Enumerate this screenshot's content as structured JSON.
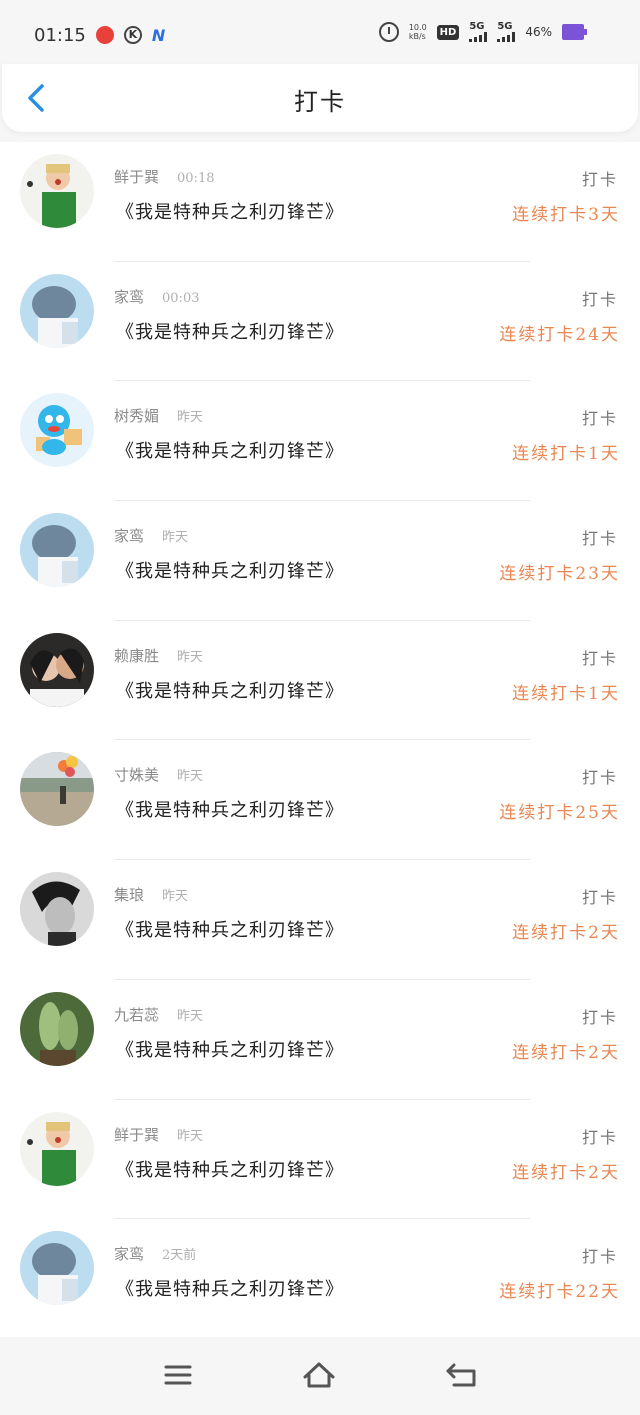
{
  "status": {
    "time": "01:15",
    "net_speed_top": "10.0",
    "net_speed_bottom": "kB/s",
    "sig1": "5G",
    "sig2": "5G",
    "battery": "46%",
    "hd": "HD"
  },
  "header": {
    "title": "打卡"
  },
  "colors": {
    "accent": "#e88752",
    "back": "#2a8fe0"
  },
  "items": [
    {
      "name": "鲜于巽",
      "time": "00:18",
      "title": "《我是特种兵之利刃锋芒》",
      "action": "打卡",
      "streak": "连续打卡3天",
      "avatar": "green-shirt"
    },
    {
      "name": "家鸾",
      "time": "00:03",
      "title": "《我是特种兵之利刃锋芒》",
      "action": "打卡",
      "streak": "连续打卡24天",
      "avatar": "blue-hair"
    },
    {
      "name": "树秀媚",
      "time": "昨天",
      "title": "《我是特种兵之利刃锋芒》",
      "action": "打卡",
      "streak": "连续打卡1天",
      "avatar": "cartoon"
    },
    {
      "name": "家鸾",
      "time": "昨天",
      "title": "《我是特种兵之利刃锋芒》",
      "action": "打卡",
      "streak": "连续打卡23天",
      "avatar": "blue-hair"
    },
    {
      "name": "赖康胜",
      "time": "昨天",
      "title": "《我是特种兵之利刃锋芒》",
      "action": "打卡",
      "streak": "连续打卡1天",
      "avatar": "couple"
    },
    {
      "name": "寸姝美",
      "time": "昨天",
      "title": "《我是特种兵之利刃锋芒》",
      "action": "打卡",
      "streak": "连续打卡25天",
      "avatar": "balloons"
    },
    {
      "name": "集琅",
      "time": "昨天",
      "title": "《我是特种兵之利刃锋芒》",
      "action": "打卡",
      "streak": "连续打卡2天",
      "avatar": "bw-man"
    },
    {
      "name": "九若蕊",
      "time": "昨天",
      "title": "《我是特种兵之利刃锋芒》",
      "action": "打卡",
      "streak": "连续打卡2天",
      "avatar": "cactus"
    },
    {
      "name": "鲜于巽",
      "time": "昨天",
      "title": "《我是特种兵之利刃锋芒》",
      "action": "打卡",
      "streak": "连续打卡2天",
      "avatar": "green-shirt"
    },
    {
      "name": "家鸾",
      "time": "2天前",
      "title": "《我是特种兵之利刃锋芒》",
      "action": "打卡",
      "streak": "连续打卡22天",
      "avatar": "blue-hair"
    }
  ]
}
